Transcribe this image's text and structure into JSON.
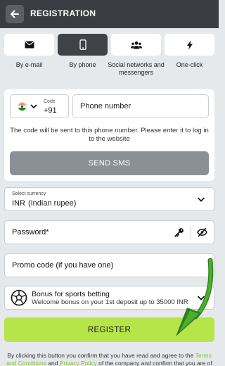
{
  "header": {
    "title": "REGISTRATION",
    "back_icon": "arrow-left-icon"
  },
  "tabs": [
    {
      "label": "By e-mail",
      "icon": "envelope-icon",
      "active": false
    },
    {
      "label": "By phone",
      "icon": "smartphone-icon",
      "active": true
    },
    {
      "label": "Social networks and messengers",
      "icon": "users-icon",
      "active": false
    },
    {
      "label": "One-click",
      "icon": "lightning-icon",
      "active": false
    }
  ],
  "phone": {
    "country_flag": "india-flag-icon",
    "code_label": "Code",
    "code_value": "+91",
    "placeholder": "Phone number",
    "note": "The code will be sent to this phone number. Please enter it to log in to the website",
    "sms_button": "SEND SMS"
  },
  "currency": {
    "label": "Select currency",
    "code": "INR",
    "name": "(Indian rupee)"
  },
  "password": {
    "placeholder": "Password*"
  },
  "promo": {
    "placeholder": "Promo code (if you have one)"
  },
  "bonus": {
    "title": "Bonus for sports betting",
    "subtitle": "Welcome bonus on your 1st deposit up to 35000 INR"
  },
  "register_button": "REGISTER",
  "terms": {
    "prefix": "By clicking this button you confirm that you have read and agree to the ",
    "link1": "Terms and Conditions",
    "middle": " and ",
    "link2": "Privacy Policy",
    "suffix": " of the company and confirm that you are of"
  },
  "colors": {
    "header_bg": "#3a3d41",
    "accent_green": "#b6e54a",
    "link_green": "#7cc228",
    "sms_button_bg": "#8b9096",
    "arrow_green": "#4caf2a"
  }
}
